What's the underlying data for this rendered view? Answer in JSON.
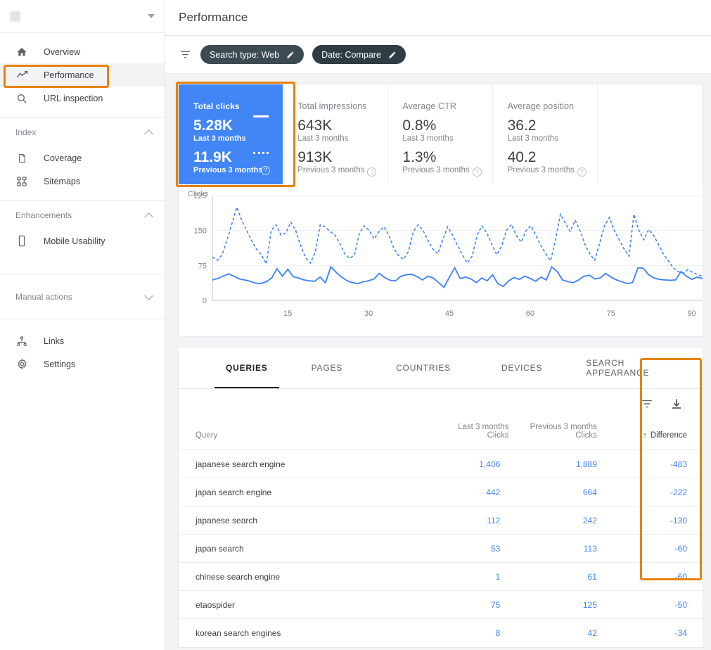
{
  "sidebar": {
    "property": {
      "name": "",
      "caret_icon": "chevron-down-icon"
    },
    "items": [
      {
        "label": "Overview",
        "icon": "home-icon"
      },
      {
        "label": "Performance",
        "icon": "trending-up-icon"
      },
      {
        "label": "URL inspection",
        "icon": "search-icon"
      }
    ],
    "groups": [
      {
        "label": "Index",
        "state_icon": "chevron-up-icon",
        "items": [
          {
            "label": "Coverage",
            "icon": "document-icon"
          },
          {
            "label": "Sitemaps",
            "icon": "sitemap-icon"
          }
        ]
      },
      {
        "label": "Enhancements",
        "state_icon": "chevron-up-icon",
        "items": [
          {
            "label": "Mobile Usability",
            "icon": "mobile-icon"
          }
        ]
      },
      {
        "label": "Manual actions",
        "state_icon": "chevron-down-icon",
        "items": []
      }
    ],
    "footer_items": [
      {
        "label": "Links",
        "icon": "links-icon"
      },
      {
        "label": "Settings",
        "icon": "gear-icon"
      }
    ]
  },
  "header": {
    "title": "Performance"
  },
  "filters": {
    "filter_icon": "filter-icon",
    "chips": [
      {
        "label": "Search type: Web",
        "edit_icon": "pencil-icon"
      },
      {
        "label": "Date: Compare",
        "edit_icon": "pencil-icon"
      }
    ]
  },
  "metrics": [
    {
      "label": "Total clicks",
      "current_value": "5.28K",
      "current_period": "Last 3 months",
      "previous_value": "11.9K",
      "previous_period": "Previous 3 months",
      "selected": true,
      "help_icon": "help-icon"
    },
    {
      "label": "Total impressions",
      "current_value": "643K",
      "current_period": "Last 3 months",
      "previous_value": "913K",
      "previous_period": "Previous 3 months",
      "selected": false,
      "help_icon": "help-icon"
    },
    {
      "label": "Average CTR",
      "current_value": "0.8%",
      "current_period": "Last 3 months",
      "previous_value": "1.3%",
      "previous_period": "Previous 3 months",
      "selected": false,
      "help_icon": "help-icon"
    },
    {
      "label": "Average position",
      "current_value": "36.2",
      "current_period": "Last 3 months",
      "previous_value": "40.2",
      "previous_period": "Previous 3 months",
      "selected": false,
      "help_icon": "help-icon"
    }
  ],
  "chart_data": {
    "type": "line",
    "title": "",
    "ylabel": "Clicks",
    "xlabel": "",
    "ylim": [
      0,
      225
    ],
    "yticks": [
      0,
      75,
      150,
      225
    ],
    "xlim": [
      1,
      92
    ],
    "xticks": [
      15,
      30,
      45,
      60,
      75,
      90
    ],
    "grid": true,
    "legend_position": "none",
    "series": [
      {
        "name": "Last 3 months",
        "style": "solid",
        "color": "#4285f4",
        "values": [
          44,
          47,
          52,
          57,
          52,
          46,
          44,
          41,
          37,
          36,
          40,
          48,
          68,
          52,
          67,
          51,
          48,
          44,
          42,
          41,
          50,
          38,
          72,
          60,
          50,
          42,
          38,
          36,
          40,
          42,
          46,
          58,
          49,
          43,
          42,
          52,
          55,
          56,
          51,
          44,
          52,
          48,
          38,
          28,
          50,
          70,
          47,
          50,
          46,
          38,
          48,
          42,
          55,
          36,
          30,
          42,
          49,
          45,
          52,
          47,
          41,
          50,
          44,
          72,
          62,
          44,
          40,
          38,
          44,
          52,
          54,
          46,
          48,
          58,
          50,
          44,
          40,
          36,
          38,
          70,
          69,
          55,
          48,
          45,
          44,
          43,
          44,
          62,
          52,
          45,
          50,
          47
        ]
      },
      {
        "name": "Previous 3 months",
        "style": "dashed",
        "color": "#4285f4",
        "values": [
          93,
          86,
          98,
          130,
          165,
          200,
          172,
          150,
          128,
          110,
          98,
          78,
          150,
          162,
          140,
          145,
          168,
          150,
          118,
          92,
          80,
          104,
          162,
          158,
          148,
          140,
          122,
          100,
          90,
          98,
          145,
          160,
          150,
          132,
          148,
          158,
          140,
          112,
          96,
          88,
          105,
          148,
          162,
          150,
          128,
          110,
          100,
          130,
          158,
          140,
          118,
          98,
          80,
          95,
          140,
          160,
          145,
          120,
          98,
          116,
          150,
          163,
          140,
          125,
          150,
          160,
          140,
          118,
          100,
          85,
          130,
          185,
          166,
          148,
          172,
          150,
          120,
          100,
          86,
          122,
          160,
          178,
          150,
          130,
          110,
          95,
          185,
          150,
          130,
          152,
          140,
          120,
          100,
          85,
          70,
          62,
          58,
          66,
          60,
          55,
          52
        ]
      }
    ]
  },
  "table": {
    "tabs": [
      {
        "label": "QUERIES",
        "active": true
      },
      {
        "label": "PAGES",
        "active": false
      },
      {
        "label": "COUNTRIES",
        "active": false
      },
      {
        "label": "DEVICES",
        "active": false
      },
      {
        "label": "SEARCH APPEARANCE",
        "active": false
      }
    ],
    "tools": [
      {
        "icon": "filter-icon",
        "name": "filter-table-button"
      },
      {
        "icon": "download-icon",
        "name": "download-button"
      }
    ],
    "columns": {
      "query": "Query",
      "current_top": "Last 3 months",
      "current_bottom": "Clicks",
      "previous_top": "Previous 3 months",
      "previous_bottom": "Clicks",
      "difference": "Difference",
      "sort_icon": "sort-ascending-arrow"
    },
    "rows": [
      {
        "query": "japanese search engine",
        "current": "1,406",
        "previous": "1,889",
        "difference": "-483"
      },
      {
        "query": "japan search engine",
        "current": "442",
        "previous": "664",
        "difference": "-222"
      },
      {
        "query": "japanese search",
        "current": "112",
        "previous": "242",
        "difference": "-130"
      },
      {
        "query": "japan search",
        "current": "53",
        "previous": "113",
        "difference": "-60"
      },
      {
        "query": "chinese search engine",
        "current": "1",
        "previous": "61",
        "difference": "-60"
      },
      {
        "query": "etaospider",
        "current": "75",
        "previous": "125",
        "difference": "-50"
      },
      {
        "query": "korean search engines",
        "current": "8",
        "previous": "42",
        "difference": "-34"
      }
    ]
  },
  "colors": {
    "accent_blue": "#4285f4",
    "highlight_orange": "#e8820c",
    "chip_dark": "#3c4a52",
    "text_primary": "#3c4043",
    "text_secondary": "#80868b"
  }
}
